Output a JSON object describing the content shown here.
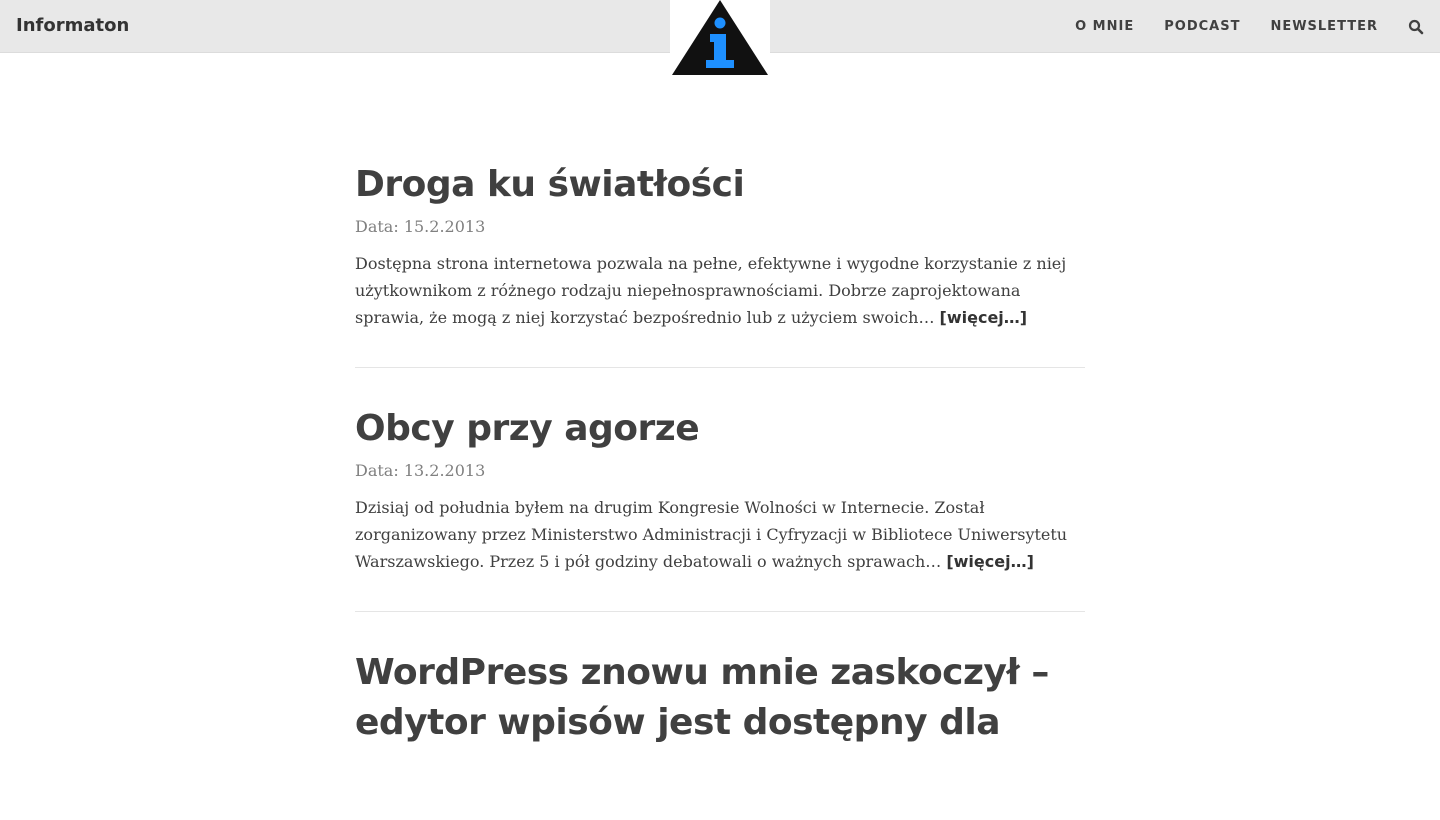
{
  "header": {
    "brand": "Informaton",
    "nav": [
      {
        "label": "O mnie"
      },
      {
        "label": "Podcast"
      },
      {
        "label": "Newsletter"
      }
    ],
    "logo_icon": "info-triangle-icon",
    "search_icon": "search-icon"
  },
  "colors": {
    "topbar_bg": "#e8e8e8",
    "text": "#404040",
    "date": "#808080",
    "logo_accent": "#1e90ff"
  },
  "posts": [
    {
      "title": "Droga ku światłości",
      "date": "Data: 15.2.2013",
      "excerpt": "Dostępna strona internetowa pozwala na pełne, efektywne i wygodne korzystanie z niej użytkownikom z różnego rodzaju niepełnosprawnościami. Dobrze zaprojektowana sprawia, że mogą z niej korzystać bezpośrednio lub z użyciem swoich… ",
      "more": "[więcej…]"
    },
    {
      "title": "Obcy przy agorze",
      "date": "Data: 13.2.2013",
      "excerpt": "Dzisiaj od południa byłem na drugim Kongresie Wolności w Internecie. Został zorganizowany przez Ministerstwo Administracji i Cyfryzacji w Bibliotece Uniwersytetu Warszawskiego. Przez 5 i pół godziny debatowali o ważnych sprawach… ",
      "more": "[więcej…]"
    },
    {
      "title": "WordPress znowu mnie zaskoczył – edytor wpisów jest dostępny dla"
    }
  ]
}
